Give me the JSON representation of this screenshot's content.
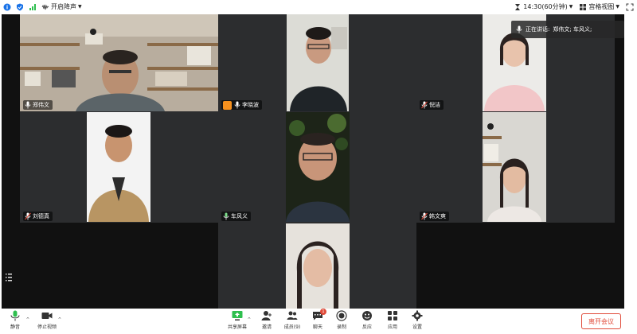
{
  "topbar": {
    "noise_label": "开启降声",
    "timer": "14:30(60分钟)",
    "view_mode": "宫格视图"
  },
  "speaking": {
    "prefix": "正在讲话:",
    "names": "郑伟文; 车风义;"
  },
  "participants": [
    {
      "name": "郑伟文"
    },
    {
      "name": "李晓波"
    },
    {
      "name": "倪洁"
    },
    {
      "name": "刘德真"
    },
    {
      "name": "车风义"
    },
    {
      "name": "韩文爽"
    }
  ],
  "toolbar": {
    "unmute": "静音",
    "video": "停止视频",
    "share": "共享屏幕",
    "invite": "邀请",
    "members": "成员(9)",
    "chat": "聊天",
    "chat_badge": "1",
    "record": "录制",
    "reactions": "反应",
    "apps": "应用",
    "settings": "设置",
    "leave": "离开会议"
  },
  "colors": {
    "active_border": "#2fbf4f",
    "leave_red": "#e04b3a",
    "tile_bg": "#2c2d2f"
  }
}
